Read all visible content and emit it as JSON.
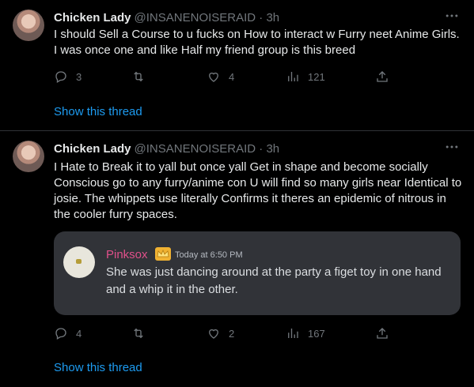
{
  "tweets": [
    {
      "name": "Chicken Lady",
      "handle": "@INSANENOISERAID · 3h",
      "text": "I should Sell a Course to u fucks on How to interact w Furry neet Anime Girls. I was once one and like Half my friend group is this breed",
      "replies": "3",
      "retweets": "",
      "likes": "4",
      "views": "121",
      "show_thread": "Show this thread"
    },
    {
      "name": "Chicken Lady",
      "handle": "@INSANENOISERAID · 3h",
      "text": "I Hate to Break it to yall but once yall Get in shape and become socially Conscious go to any furry/anime con U will find so many girls near Identical to josie. The whippets use literally Confirms it theres an epidemic of nitrous in the cooler furry spaces.",
      "replies": "4",
      "retweets": "",
      "likes": "2",
      "views": "167",
      "show_thread": "Show this thread",
      "embed": {
        "username": "Pinksox",
        "time": "Today at 6:50 PM",
        "message": "She was just dancing around at the party a figet toy in one hand and a whip it in the other."
      }
    }
  ],
  "colors": {
    "accent": "#1d9bf0",
    "muted": "#71767b",
    "background": "#000000",
    "embed_bg": "#313338",
    "embed_username": "#e0508a"
  }
}
